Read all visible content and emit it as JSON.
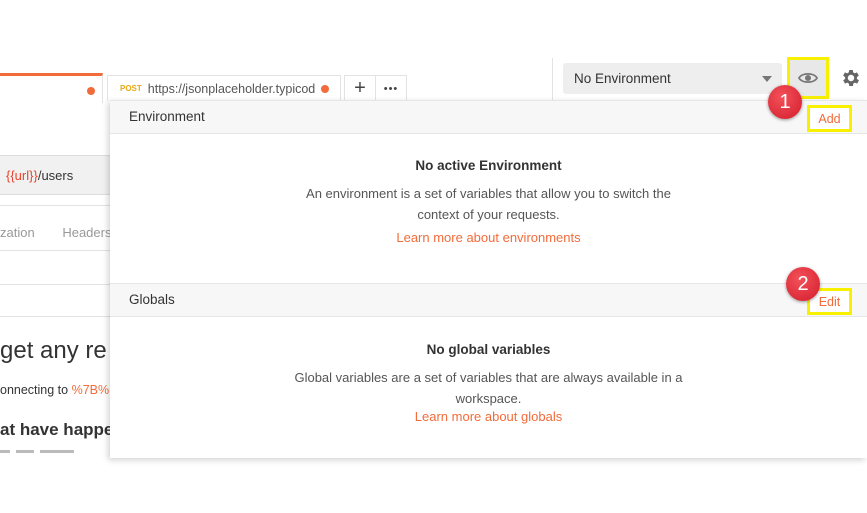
{
  "tabs": {
    "request_tab_2": {
      "method": "POST",
      "url": "https://jsonplaceholder.typicod"
    },
    "add_tab_label": "+",
    "more_tabs_label": "•••"
  },
  "environment_selector": {
    "selected": "No Environment"
  },
  "background_request": {
    "url_var": "{{url}}",
    "url_path": "/users",
    "subtabs": [
      "zation",
      "Headers"
    ],
    "response_heading": "get any re",
    "connecting_prefix": "onnecting to ",
    "connecting_link": "%7B%",
    "section_heading": "at have happe"
  },
  "popup": {
    "environment": {
      "title": "Environment",
      "add_label": "Add",
      "empty_heading": "No active Environment",
      "description": "An environment is a set of variables that allow you to switch the context of your requests.",
      "learn_more": "Learn more about environments"
    },
    "globals": {
      "title": "Globals",
      "edit_label": "Edit",
      "empty_heading": "No global variables",
      "description": "Global variables are a set of variables that are always available in a workspace.",
      "learn_more": "Learn more about globals"
    }
  },
  "annotations": {
    "badge_1": "1",
    "badge_2": "2"
  },
  "colors": {
    "accent_orange": "#f26b3a",
    "highlight_yellow": "#f7f100",
    "badge_red": "#d41b2b",
    "post_method": "#e6a817"
  }
}
